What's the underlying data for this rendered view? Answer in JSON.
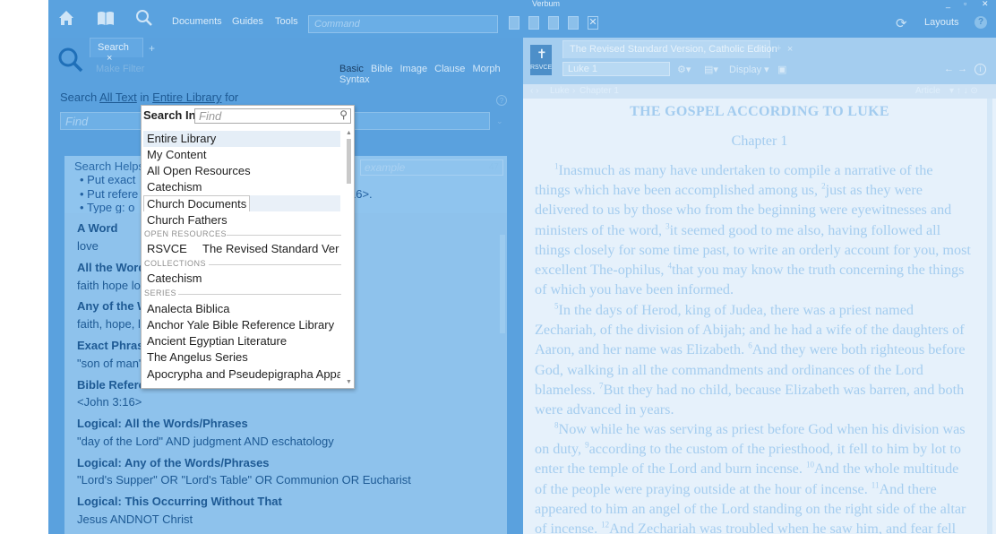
{
  "window": {
    "title": "Verbum",
    "controls": [
      "_",
      "▫",
      "✕"
    ]
  },
  "toolbar": {
    "icons": [
      "home-icon",
      "library-icon",
      "search-icon"
    ],
    "links": [
      "Documents",
      "Guides",
      "Tools"
    ],
    "command_placeholder": "Command",
    "layouts_label": "Layouts",
    "help_label": "?"
  },
  "search_panel": {
    "tab_label": "Search",
    "tab_close": "×",
    "tab_add": "+",
    "make_filter": "Make Filter",
    "search_types": [
      "Basic",
      "Bible",
      "Image",
      "Clause",
      "Morph",
      "Syntax"
    ],
    "active_type": "Basic",
    "scope_line": {
      "prefix": "Search",
      "all_text": "All Text",
      "in": "in",
      "library": "Entire Library",
      "for": "for"
    },
    "find_placeholder": "Find",
    "helps": {
      "title": "Search Helps",
      "example_placeholder": "example",
      "example_count": "47",
      "bullets": [
        "Put exact",
        "Put refere",
        "Type g: o"
      ],
      "bullet_suffix": "16>."
    },
    "examples": [
      {
        "heading": "A Word",
        "value": "love"
      },
      {
        "heading": "All the Words",
        "value": "faith hope lov"
      },
      {
        "heading": "Any of the W",
        "value": "faith, hope, lo"
      },
      {
        "heading": "Exact Phrase",
        "value": "\"son of man\""
      },
      {
        "heading": "Bible Referen",
        "value": "<John 3:16>"
      },
      {
        "heading": "Logical: All the Words/Phrases",
        "value": "\"day of the Lord\" AND judgment AND eschatology"
      },
      {
        "heading": "Logical: Any of the Words/Phrases",
        "value": "\"Lord's Supper\" OR \"Lord's Table\" OR Communion OR Eucharist"
      },
      {
        "heading": "Logical: This Occurring Without That",
        "value": "Jesus ANDNOT Christ"
      }
    ]
  },
  "search_in_dropdown": {
    "title": "Search In",
    "find_placeholder": "Find",
    "items": [
      "Entire Library",
      "My Content",
      "All Open Resources",
      "Catechism",
      "Church Documents",
      "Church Fathers"
    ],
    "selected": "Entire Library",
    "hovered": "Church Documents",
    "open_resources_label": "OPEN RESOURCES",
    "open_resources": [
      {
        "code": "RSVCE",
        "name": "The Revised Standard Ver…"
      }
    ],
    "collections_label": "COLLECTIONS",
    "collections": [
      "Catechism"
    ],
    "series_label": "SERIES",
    "series": [
      "Analecta Biblica",
      "Anchor Yale Bible Reference Library",
      "Ancient Egyptian Literature",
      "The Angelus Series",
      "Apocrypha and Pseudepigrapha Appa…"
    ]
  },
  "reader": {
    "resource_icon_label": "RSVCE",
    "tab_title": "The Revised Standard Version, Catholic Edition",
    "tab_close": "×",
    "tab_add": "+",
    "reference": "Luke 1",
    "display_label": "Display",
    "breadcrumb": [
      "Luke",
      "Chapter 1"
    ],
    "article_label": "Article",
    "book_title": "THE GOSPEL ACCORDING TO LUKE",
    "chapter_title": "Chapter 1",
    "verses": [
      {
        "num": "1",
        "text": "Inasmuch as many have undertaken to compile a narrative of the things which have been accomplished among us,"
      },
      {
        "num": "2",
        "text": "just as they were delivered to us by those who from the beginning were eyewitnesses and ministers of the word,"
      },
      {
        "num": "3",
        "text": "it seemed good to me also, having followed all things closely for some time past, to write an orderly account for you, most excellent The-ophilus,"
      },
      {
        "num": "4",
        "text": "that you may know the truth concerning the things of which you have been informed."
      },
      {
        "num": "5",
        "text": "In the days of Herod, king of Judea, there was a priest named Zechariah, of the division of Abijah; and he had a wife of the daughters of Aaron, and her name was Elizabeth."
      },
      {
        "num": "6",
        "text": "And they were both righteous before God, walking in all the commandments and ordinances of the Lord blameless."
      },
      {
        "num": "7",
        "text": "But they had no child, because Elizabeth was barren, and both were advanced in years."
      },
      {
        "num": "8",
        "text": "Now while he was serving as priest before God when his division was on duty,"
      },
      {
        "num": "9",
        "text": "according to the custom of the priesthood, it fell to him by lot to enter the temple of the Lord and burn incense."
      },
      {
        "num": "10",
        "text": "And the whole multitude of the people were praying outside at the hour of incense."
      },
      {
        "num": "11",
        "text": "And there appeared to him an angel of the Lord standing on the right side of the altar of incense."
      },
      {
        "num": "12",
        "text": "And Zechariah was troubled when he saw him, and fear fell"
      }
    ]
  }
}
